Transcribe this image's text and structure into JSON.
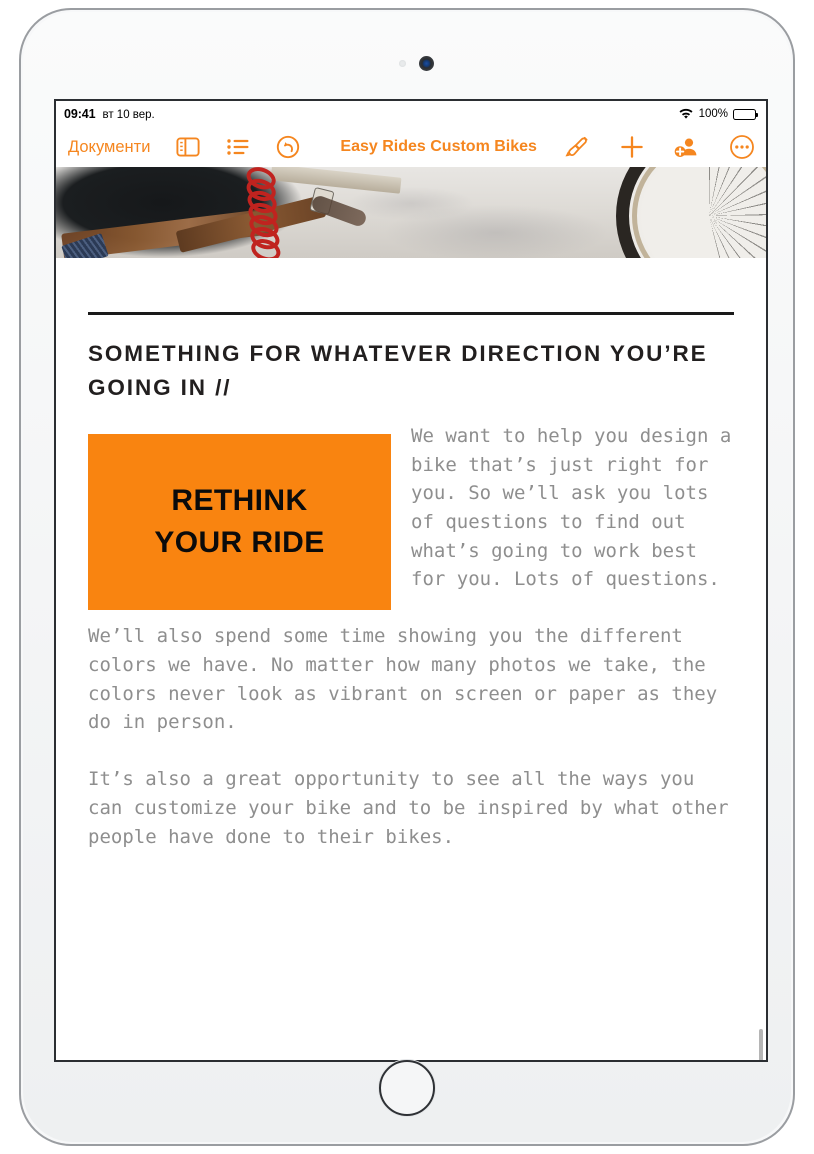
{
  "status_bar": {
    "time": "09:41",
    "date": "вт 10 вер.",
    "wifi_icon": "wifi-icon",
    "battery_percent": "100%",
    "battery_icon": "battery-full-icon"
  },
  "toolbar": {
    "back_label": "Документи",
    "view_icon": "sidebar-view-icon",
    "list_icon": "outline-list-icon",
    "undo_icon": "undo-arrow-icon",
    "document_title": "Easy Rides Custom Bikes",
    "format_icon": "paintbrush-format-icon",
    "insert_icon": "plus-insert-icon",
    "collaborate_icon": "add-person-collaborate-icon",
    "more_icon": "more-ellipsis-icon"
  },
  "document": {
    "hero_image_alt": "bicycle-workshop-photo",
    "heading": "SOMETHING FOR WHATEVER DIRECTION YOU’RE GOING IN //",
    "paragraph_1": "We want to help you design a bike that’s just right for you. So we’ll ask you lots of questions to find out what’s going to work best for you. Lots of questions.",
    "paragraph_2": "We’ll also spend some time showing you the different colors we have. No matter how many photos we take, the colors never look as vibrant on screen or paper as they do in person.",
    "paragraph_3": "It’s also a great opportunity to see all the ways you can customize your bike and to be inspired by what other people have done to their bikes.",
    "callout": {
      "line_1": "RETHINK",
      "line_2": "YOUR RIDE",
      "background_color": "#f98410",
      "text_color": "#0b0b0b"
    }
  },
  "colors": {
    "accent": "#f5861f",
    "body_text": "#8e8e8e",
    "heading_text": "#221f1f"
  }
}
